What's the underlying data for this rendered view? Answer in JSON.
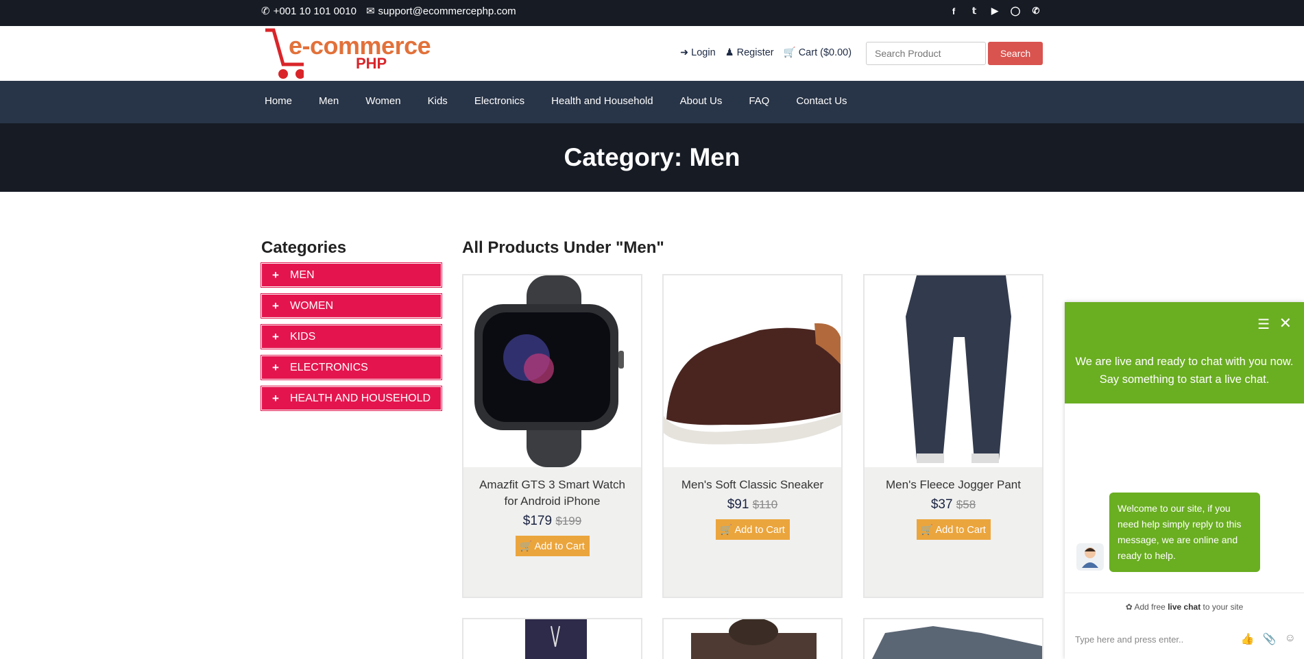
{
  "topbar": {
    "phone": "+001 10 101 0010",
    "email": "support@ecommercephp.com",
    "social": [
      "facebook-icon",
      "twitter-icon",
      "youtube-icon",
      "instagram-icon",
      "whatsapp-icon"
    ]
  },
  "header": {
    "logo_main": "e-commerce",
    "logo_sub": "PHP",
    "login": "Login",
    "register": "Register",
    "cart": "Cart ($0.00)",
    "search_placeholder": "Search Product",
    "search_button": "Search"
  },
  "nav": [
    "Home",
    "Men",
    "Women",
    "Kids",
    "Electronics",
    "Health and Household",
    "About Us",
    "FAQ",
    "Contact Us"
  ],
  "banner": {
    "title": "Category: Men"
  },
  "sidebar": {
    "title": "Categories",
    "items": [
      "MEN",
      "WOMEN",
      "KIDS",
      "ELECTRONICS",
      "HEALTH AND HOUSEHOLD"
    ]
  },
  "main": {
    "title": "All Products Under \"Men\"",
    "products": [
      {
        "name": "Amazfit GTS 3 Smart Watch for Android iPhone",
        "price": "$179",
        "old_price": "$199",
        "button": "Add to Cart"
      },
      {
        "name": "Men's Soft Classic Sneaker",
        "price": "$91",
        "old_price": "$110",
        "button": "Add to Cart"
      },
      {
        "name": "Men's Fleece Jogger Pant",
        "price": "$37",
        "old_price": "$58",
        "button": "Add to Cart"
      }
    ]
  },
  "chat": {
    "header_message": "We are live and ready to chat with you now. Say something to start a live chat.",
    "welcome": "Welcome to our site, if you need help simply reply to this message, we are online and ready to help.",
    "powered_pre": "Add free ",
    "powered_bold": "live chat",
    "powered_post": " to your site",
    "input_placeholder": "Type here and press enter.."
  },
  "colors": {
    "topbar": "#161b24",
    "nav": "#283447",
    "category": "#e4154e",
    "add_to_cart": "#eba53d",
    "search_button": "#d9534f",
    "chat_green": "#6aae21"
  }
}
